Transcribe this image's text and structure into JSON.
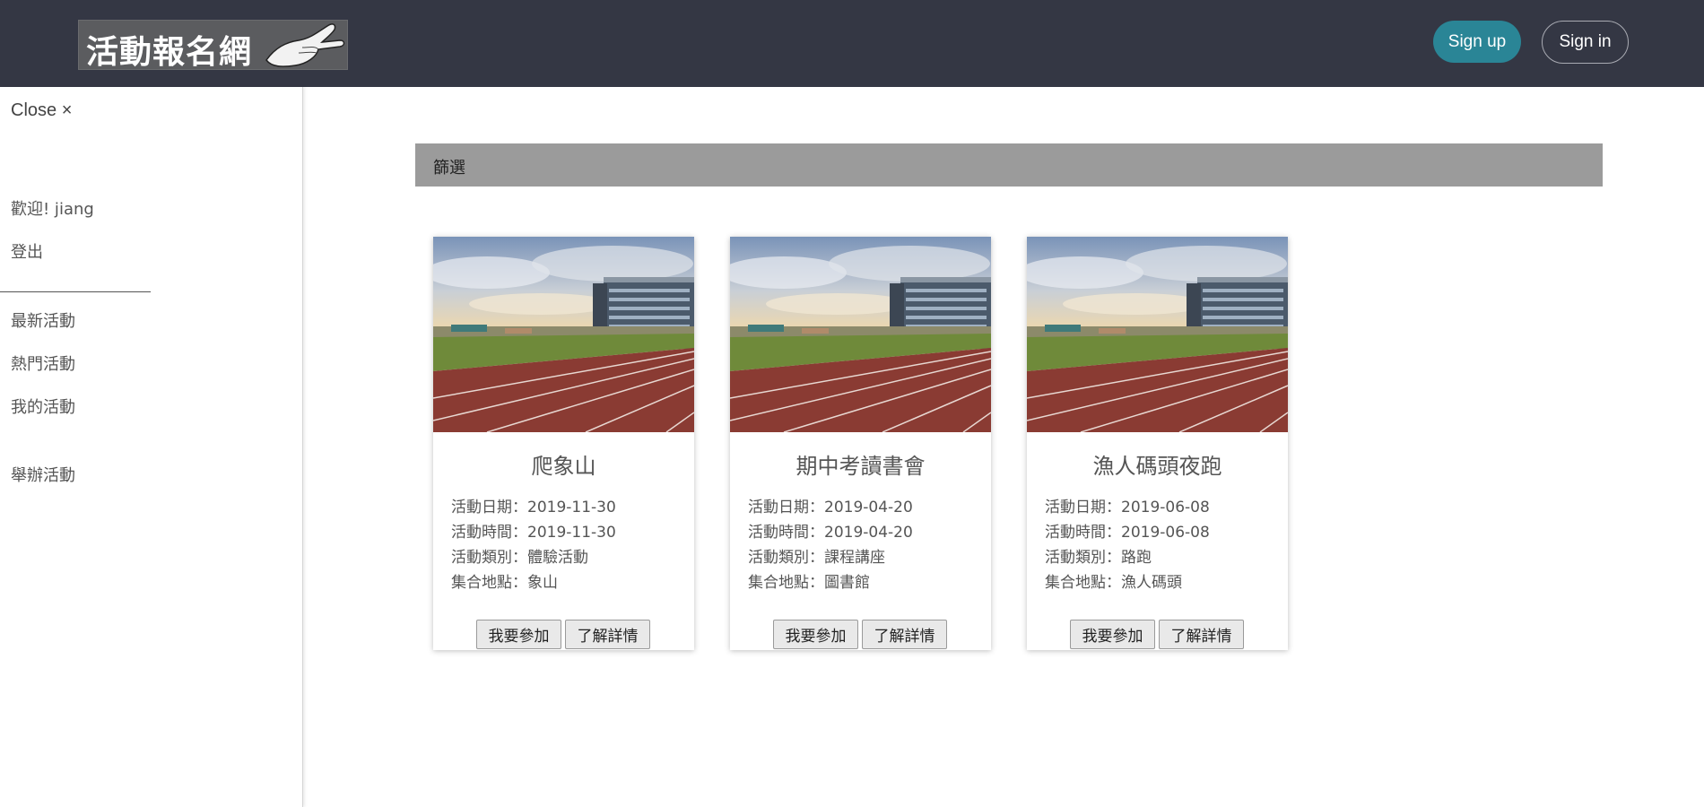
{
  "header": {
    "logo_text": "活動報名網",
    "signup_label": "Sign up",
    "signin_label": "Sign in"
  },
  "sidebar": {
    "close_label": "Close ×",
    "welcome": "歡迎! jiang",
    "logout": "登出",
    "nav": [
      {
        "label": "最新活動"
      },
      {
        "label": "熱門活動"
      },
      {
        "label": "我的活動"
      },
      {
        "label": "舉辦活動"
      }
    ]
  },
  "filter": {
    "label": "篩選"
  },
  "cards": [
    {
      "title": "爬象山",
      "date": "活動日期：2019-11-30",
      "time": "活動時間：2019-11-30",
      "category": "活動類別：體驗活動",
      "location": "集合地點：象山",
      "join_label": "我要參加",
      "detail_label": "了解詳情"
    },
    {
      "title": "期中考讀書會",
      "date": "活動日期：2019-04-20",
      "time": "活動時間：2019-04-20",
      "category": "活動類別：課程講座",
      "location": "集合地點：圖書館",
      "join_label": "我要參加",
      "detail_label": "了解詳情"
    },
    {
      "title": "漁人碼頭夜跑",
      "date": "活動日期：2019-06-08",
      "time": "活動時間：2019-06-08",
      "category": "活動類別：路跑",
      "location": "集合地點：漁人碼頭",
      "join_label": "我要參加",
      "detail_label": "了解詳情"
    }
  ],
  "colors": {
    "topbar": "#343744",
    "signup": "#2a8596",
    "filter_bar": "#9b9b9b"
  },
  "icons": {
    "logo_image": "hand-icon",
    "card_image": "stadium-photo"
  }
}
